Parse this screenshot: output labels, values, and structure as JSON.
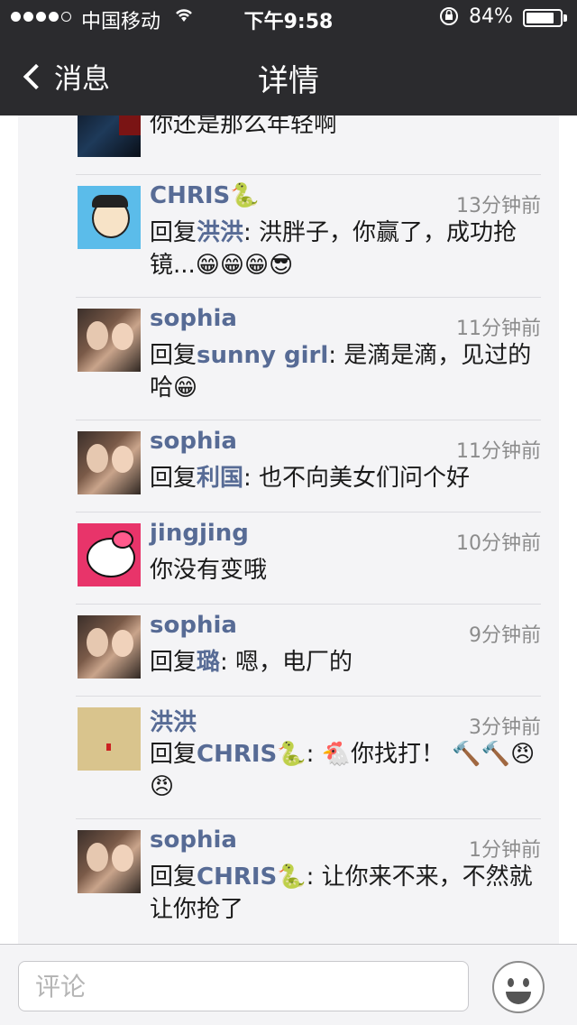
{
  "status_bar": {
    "carrier": "中国移动",
    "time": "下午9:58",
    "battery_percent": "84%",
    "battery_level": 0.84,
    "signal_dots_filled": 4,
    "signal_dots_total": 5
  },
  "nav": {
    "back_label": "消息",
    "title": "详情"
  },
  "comments": [
    {
      "name": "",
      "time": "",
      "text": "你还是那么年轻啊"
    },
    {
      "name": "CHRIS🐍",
      "time": "13分钟前",
      "reply_prefix": "回复",
      "reply_to": "洪洪",
      "text": ": 洪胖子，你赢了，成功抢镜...😁😁😁😎"
    },
    {
      "name": "sophia",
      "time": "11分钟前",
      "reply_prefix": "回复",
      "reply_to": "sunny girl",
      "text": ": 是滴是滴，见过的哈😁"
    },
    {
      "name": "sophia",
      "time": "11分钟前",
      "reply_prefix": "回复",
      "reply_to": "利国",
      "text": ": 也不向美女们问个好"
    },
    {
      "name": "jingjing",
      "time": "10分钟前",
      "text": "你没有变哦"
    },
    {
      "name": "sophia",
      "time": "9分钟前",
      "reply_prefix": "回复",
      "reply_to": "璐",
      "text": ": 嗯，电厂的"
    },
    {
      "name": "洪洪",
      "time": "3分钟前",
      "reply_prefix": "回复",
      "reply_to": "CHRIS🐍",
      "text": ": 🐔你找打！ 🔨🔨😠😠"
    },
    {
      "name": "sophia",
      "time": "1分钟前",
      "reply_prefix": "回复",
      "reply_to": "CHRIS🐍",
      "text": ": 让你来不来，不然就让你抢了"
    }
  ],
  "input": {
    "placeholder": "评论"
  },
  "icons": {
    "wifi": "wifi-icon",
    "lock": "orientation-lock-icon",
    "battery": "battery-icon",
    "back": "chevron-left-icon",
    "emoji": "smiley-icon"
  },
  "colors": {
    "nav_bg": "#2b2b2e",
    "name_link": "#576b95",
    "panel_bg": "#f4f4f6"
  }
}
